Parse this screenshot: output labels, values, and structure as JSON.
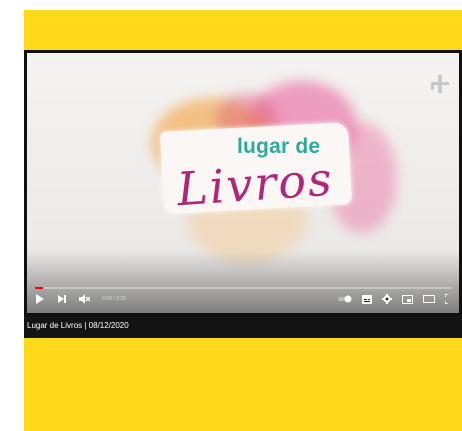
{
  "colors": {
    "frame_yellow": "#ffd91a",
    "player_black": "#101010",
    "progress_red": "#ff0000",
    "title_teal": "#2bab9c",
    "title_magenta": "#b2267a"
  },
  "video": {
    "title_line1": "lugar de",
    "title_line2": "Livros",
    "corner_logo_icon": "brand-plus-icon"
  },
  "controls": {
    "play_icon": "play-icon",
    "next_icon": "next-icon",
    "mute_icon": "volume-muted-icon",
    "current_time": "0:00",
    "separator": " / ",
    "duration": "3:29",
    "progress_fraction": 0.02,
    "settings_icons": [
      "autoplay-toggle-icon",
      "subtitles-icon",
      "gear-icon",
      "miniplayer-icon",
      "theater-mode-icon",
      "fullscreen-icon"
    ]
  },
  "caption": {
    "text": "Lugar de Livros | 08/12/2020"
  }
}
